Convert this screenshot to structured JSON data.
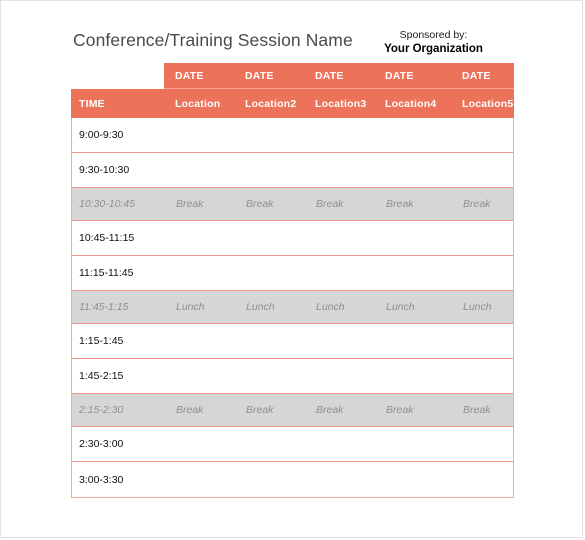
{
  "document": {
    "title": "Conference/Training Session Name",
    "sponsor_label": "Sponsored by:",
    "sponsor_name": "Your Organization"
  },
  "table": {
    "date_headers": [
      "DATE",
      "DATE",
      "DATE",
      "DATE",
      "DATE"
    ],
    "time_column_header": "TIME",
    "location_headers": [
      "Location",
      "Location2",
      "Location3",
      "Location4",
      "Location5"
    ],
    "colors": {
      "header_orange": "#ec7259",
      "row_border": "#f2988a",
      "special_row_background": "#d6d6d6",
      "special_row_text": "#8f8f8f",
      "title_text": "#4a4a4a"
    },
    "rows": [
      {
        "type": "normal",
        "time": "9:00-9:30",
        "cells": [
          "",
          "",
          "",
          "",
          ""
        ]
      },
      {
        "type": "normal",
        "time": "9:30-10:30",
        "cells": [
          "",
          "",
          "",
          "",
          ""
        ]
      },
      {
        "type": "special",
        "time": "10:30-10:45",
        "cells": [
          "Break",
          "Break",
          "Break",
          "Break",
          "Break"
        ]
      },
      {
        "type": "normal",
        "time": "10:45-11:15",
        "cells": [
          "",
          "",
          "",
          "",
          ""
        ]
      },
      {
        "type": "normal",
        "time": "11:15-11:45",
        "cells": [
          "",
          "",
          "",
          "",
          ""
        ]
      },
      {
        "type": "special",
        "time": "11:45-1:15",
        "cells": [
          "Lunch",
          "Lunch",
          "Lunch",
          "Lunch",
          "Lunch"
        ]
      },
      {
        "type": "normal",
        "time": "1:15-1:45",
        "cells": [
          "",
          "",
          "",
          "",
          ""
        ]
      },
      {
        "type": "normal",
        "time": "1:45-2:15",
        "cells": [
          "",
          "",
          "",
          "",
          ""
        ]
      },
      {
        "type": "special",
        "time": "2:15-2:30",
        "cells": [
          "Break",
          "Break",
          "Break",
          "Break",
          "Break"
        ]
      },
      {
        "type": "normal",
        "time": "2:30-3:00",
        "cells": [
          "",
          "",
          "",
          "",
          ""
        ]
      },
      {
        "type": "normal",
        "time": "3:00-3:30",
        "cells": [
          "",
          "",
          "",
          "",
          ""
        ]
      }
    ]
  }
}
